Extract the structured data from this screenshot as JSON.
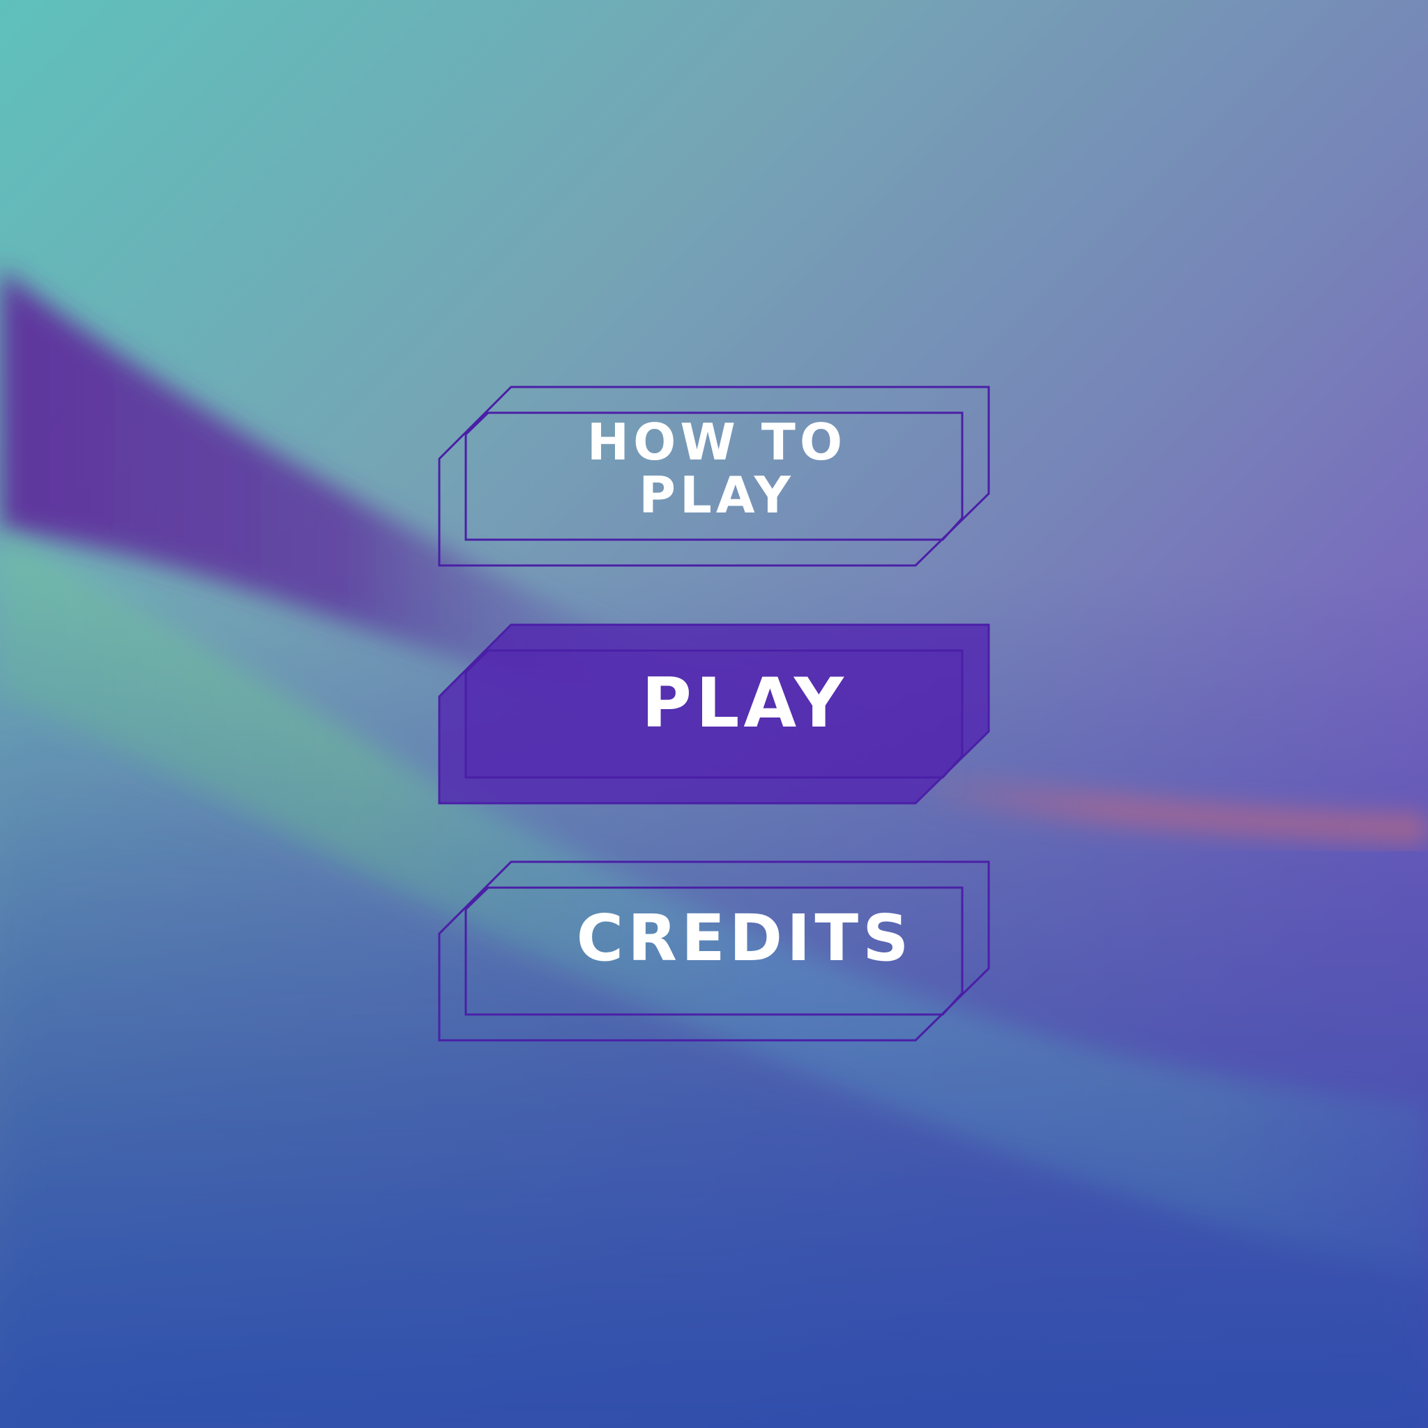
{
  "menu": {
    "how_to_play": "HOW TO PLAY",
    "play": "PLAY",
    "credits": "CREDITS",
    "selected": "play"
  },
  "colors": {
    "outline": "#4a1fa6",
    "selected_fill": "#5224b0",
    "label": "#ffffff"
  }
}
